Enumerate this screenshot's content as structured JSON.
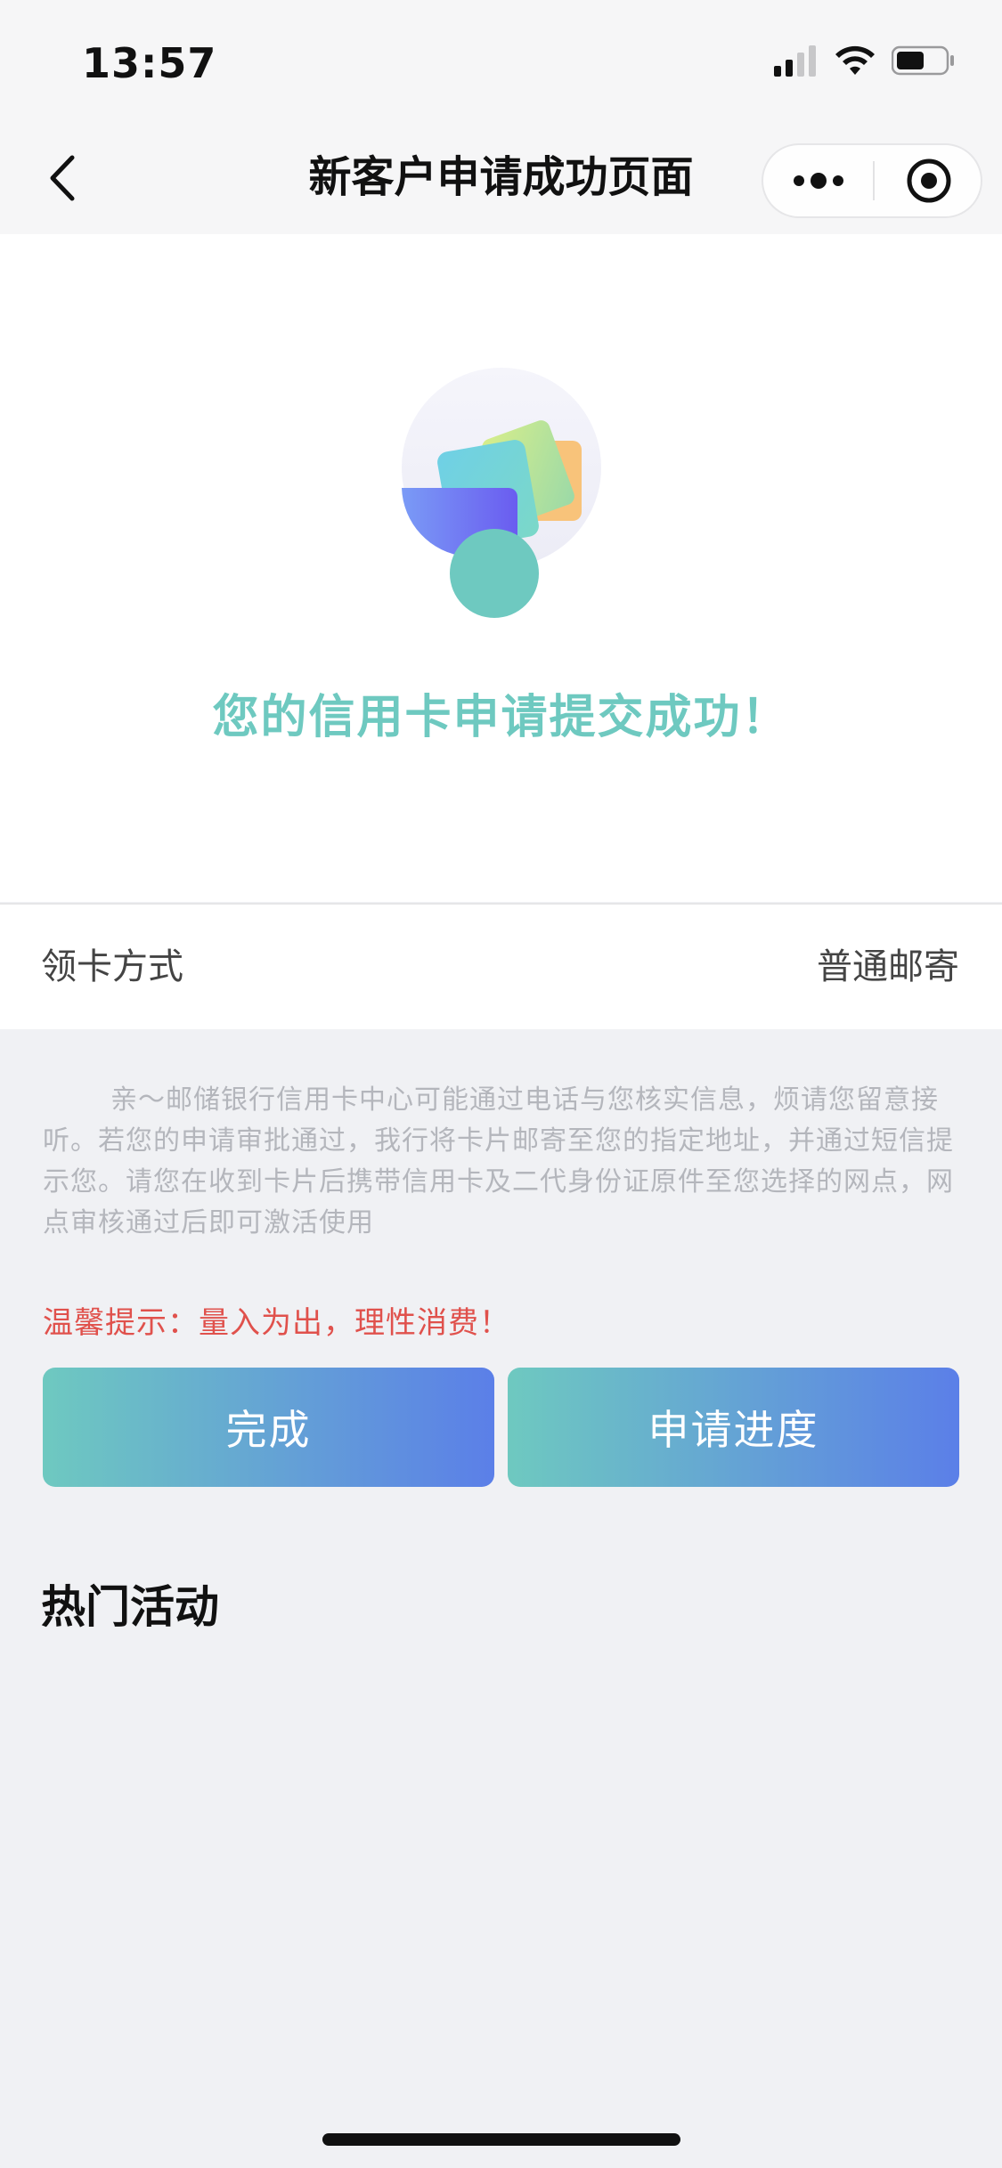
{
  "status_bar": {
    "time": "13:57",
    "icons": [
      "cellular-signal-icon",
      "wifi-icon",
      "battery-icon"
    ]
  },
  "nav": {
    "title": "新客户申请成功页面",
    "icons": [
      "back-arrow-icon",
      "more-dots-icon",
      "close-target-icon"
    ]
  },
  "success": {
    "message": "您的信用卡申请提交成功！",
    "accent_color": "#6ec9c0"
  },
  "card_method": {
    "label": "领卡方式",
    "value": "普通邮寄"
  },
  "notice": {
    "text": "亲～邮储银行信用卡中心可能通过电话与您核实信息，烦请您留意接听。若您的申请审批通过，我行将卡片邮寄至您的指定地址，并通过短信提示您。请您在收到卡片后携带信用卡及二代身份证原件至您选择的网点，网点审核通过后即可激活使用"
  },
  "tip": {
    "text": "温馨提示：量入为出，理性消费！",
    "color": "#e0514c"
  },
  "buttons": {
    "done_label": "完成",
    "progress_label": "申请进度",
    "gradient_start": "#6ec9c0",
    "gradient_end": "#5b7fe8"
  },
  "hot_activities": {
    "title": "热门活动"
  }
}
